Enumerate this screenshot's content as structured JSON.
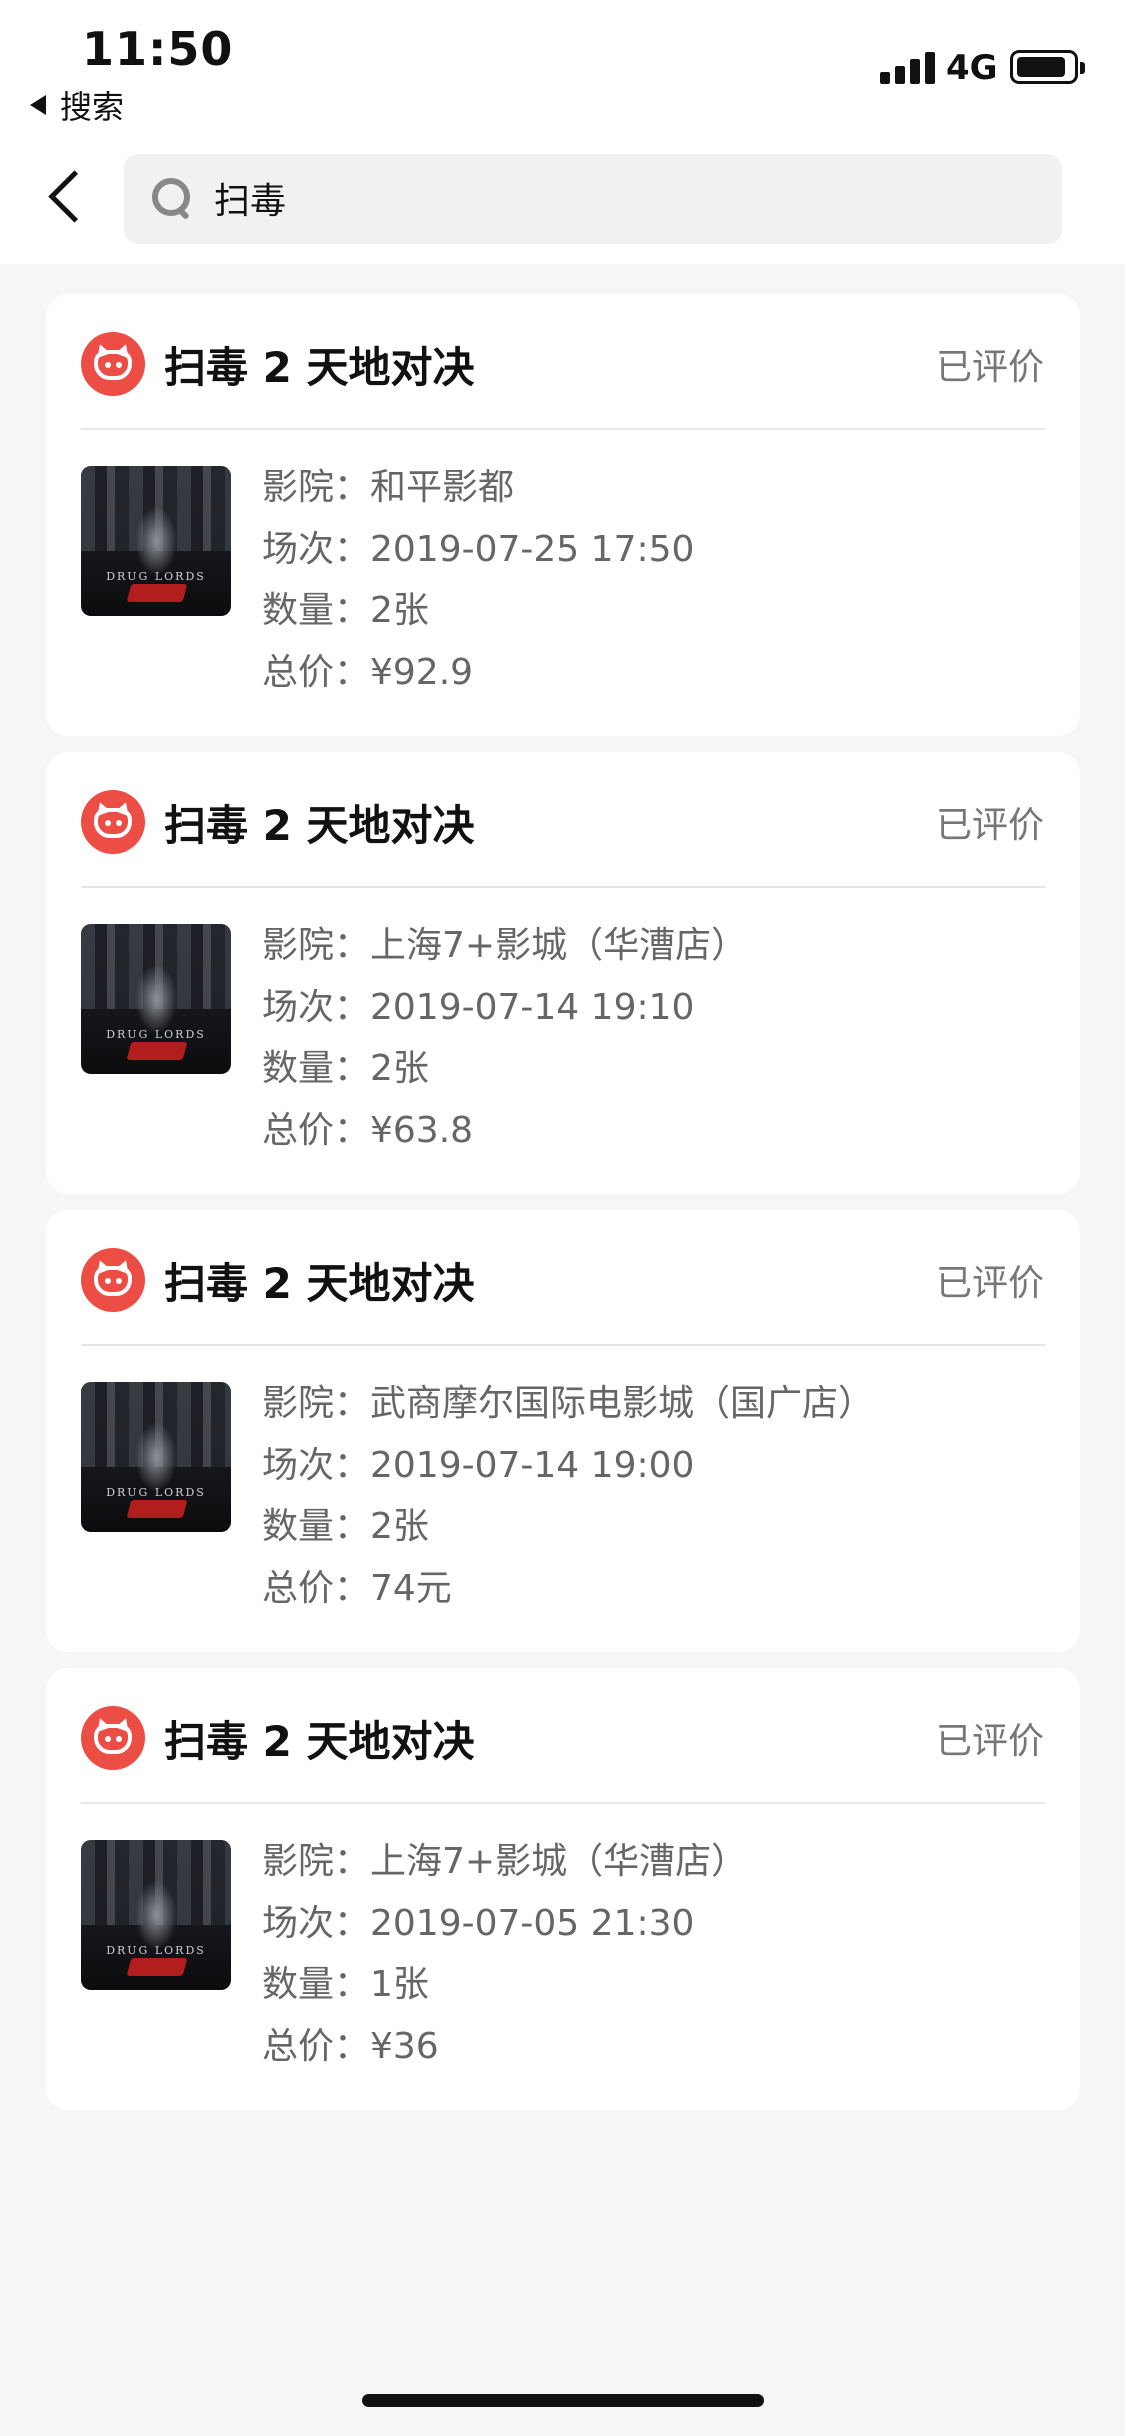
{
  "status_bar": {
    "time": "11:50",
    "back_app_label": "搜索",
    "network": "4G"
  },
  "search": {
    "query": "扫毒"
  },
  "orders": [
    {
      "title": "扫毒 2 天地对决",
      "status": "已评价",
      "poster_text": "DRUG LORDS",
      "cinema": "影院：和平影都",
      "session": "场次：2019-07-25 17:50",
      "quantity": "数量：2张",
      "total": "总价：¥92.9"
    },
    {
      "title": "扫毒 2 天地对决",
      "status": "已评价",
      "poster_text": "DRUG LORDS",
      "cinema": "影院：上海7+影城（华漕店）",
      "session": "场次：2019-07-14 19:10",
      "quantity": "数量：2张",
      "total": "总价：¥63.8"
    },
    {
      "title": "扫毒 2 天地对决",
      "status": "已评价",
      "poster_text": "DRUG LORDS",
      "cinema": "影院：武商摩尔国际电影城（国广店）",
      "session": "场次：2019-07-14 19:00",
      "quantity": "数量：2张",
      "total": "总价：74元"
    },
    {
      "title": "扫毒 2 天地对决",
      "status": "已评价",
      "poster_text": "DRUG LORDS",
      "cinema": "影院：上海7+影城（华漕店）",
      "session": "场次：2019-07-05 21:30",
      "quantity": "数量：1张",
      "total": "总价：¥36"
    }
  ],
  "colors": {
    "brand_red": "#ec4d45",
    "background": "#f6f6f6",
    "secondary_text": "#666666"
  },
  "icons": {
    "back": "chevron-left-icon",
    "search": "search-icon",
    "logo": "maoyan-cat-logo-icon"
  }
}
